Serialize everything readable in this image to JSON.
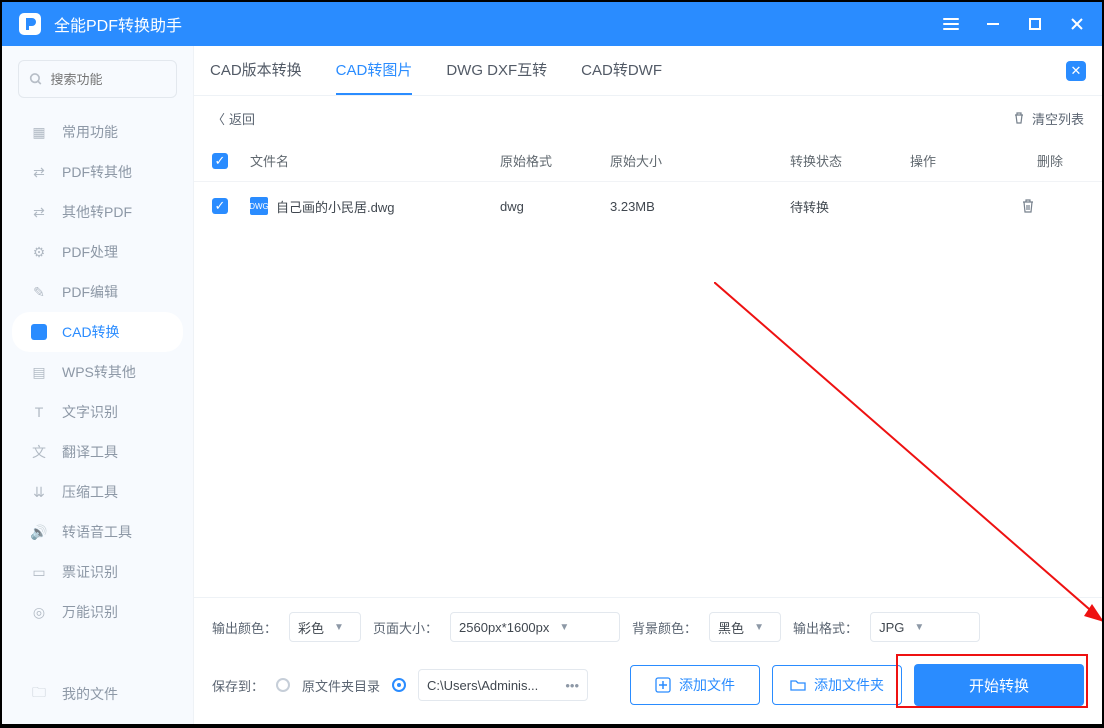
{
  "titlebar": {
    "title": "全能PDF转换助手"
  },
  "sidebar": {
    "search_placeholder": "搜索功能",
    "items": [
      {
        "label": "常用功能"
      },
      {
        "label": "PDF转其他"
      },
      {
        "label": "其他转PDF"
      },
      {
        "label": "PDF处理"
      },
      {
        "label": "PDF编辑"
      },
      {
        "label": "CAD转换"
      },
      {
        "label": "WPS转其他"
      },
      {
        "label": "文字识别"
      },
      {
        "label": "翻译工具"
      },
      {
        "label": "压缩工具"
      },
      {
        "label": "转语音工具"
      },
      {
        "label": "票证识别"
      },
      {
        "label": "万能识别"
      }
    ],
    "bottom_item": {
      "label": "我的文件"
    }
  },
  "tabs": {
    "items": [
      "CAD版本转换",
      "CAD转图片",
      "DWG DXF互转",
      "CAD转DWF"
    ],
    "active_index": 1
  },
  "subbar": {
    "back": "返回",
    "clear": "清空列表"
  },
  "table": {
    "headers": {
      "filename": "文件名",
      "format": "原始格式",
      "size": "原始大小",
      "state": "转换状态",
      "operate": "操作",
      "delete": "删除"
    },
    "rows": [
      {
        "name": "自己画的小民居.dwg",
        "format": "dwg",
        "size": "3.23MB",
        "state": "待转换"
      }
    ]
  },
  "options": {
    "output_color_label": "输出颜色：",
    "output_color": "彩色",
    "page_size_label": "页面大小：",
    "page_size": "2560px*1600px",
    "bg_color_label": "背景颜色：",
    "bg_color": "黑色",
    "output_format_label": "输出格式：",
    "output_format": "JPG"
  },
  "saverow": {
    "save_to_label": "保存到：",
    "radio_origin": "原文件夹目录",
    "path_value": "C:\\Users\\Adminis...",
    "add_file": "添加文件",
    "add_folder": "添加文件夹",
    "start": "开始转换"
  }
}
